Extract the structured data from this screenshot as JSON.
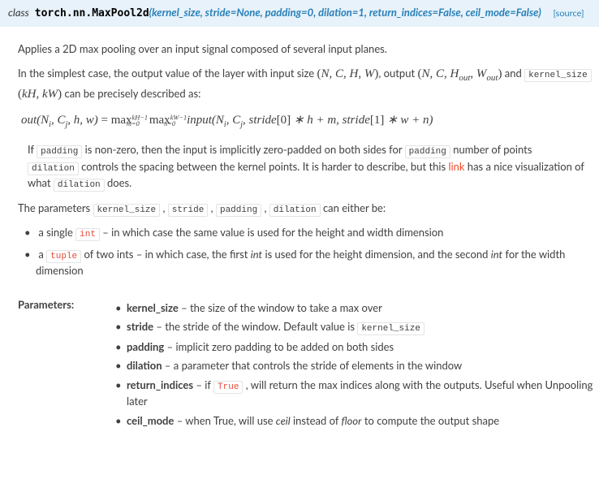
{
  "signature": {
    "keyword": "class",
    "module": "torch.nn.",
    "classname": "MaxPool2d",
    "args": "(kernel_size, stride=None, padding=0, dilation=1, return_indices=False, ceil_mode=False)",
    "source_label": "[source]"
  },
  "intro": "Applies a 2D max pooling over an input signal composed of several input planes.",
  "simple_case": {
    "prefix": "In the simplest case, the output value of the layer with input size ",
    "inout_sizes_1": "(N, C, H, W)",
    "mid1": ", output ",
    "inout_sizes_2": "(N, C, H_out, W_out)",
    "mid2": " and ",
    "ks_code": "kernel_size",
    "ks_math": " (kH, kW)",
    "suffix": " can be precisely described as:"
  },
  "formula_text": "out(N_i, C_j, h, w) = max_{m=0}^{kH-1} max_{n=0}^{kW-1} input(N_i, C_j, stride[0]*h + m, stride[1]*w + n)",
  "padding_note": {
    "p1a": "If ",
    "p1_code1": "padding",
    "p1b": " is non-zero, then the input is implicitly zero-padded on both sides for ",
    "p1_code2": "padding",
    "p1c": " number of points",
    "p2_code": "dilation",
    "p2a": " controls the spacing between the kernel points. It is harder to describe, but this ",
    "p2_link": "link",
    "p2b": " has a nice visualization of what ",
    "p2_code2": "dilation",
    "p2c": " does."
  },
  "either_be": {
    "prefix": "The parameters ",
    "codes": [
      "kernel_size",
      "stride",
      "padding",
      "dilation"
    ],
    "suffix": " can either be:"
  },
  "either_list": [
    {
      "pre": "a single ",
      "code": "int",
      "post": " – in which case the same value is used for the height and width dimension"
    },
    {
      "pre": "a ",
      "code": "tuple",
      "post1": " of two ints – in which case, the first ",
      "em1": "int",
      "post2": " is used for the height dimension, and the second ",
      "em2": "int",
      "post3": " for the width dimension"
    }
  ],
  "params_label": "Parameters:",
  "params": [
    {
      "name": "kernel_size",
      "desc": " – the size of the window to take a max over"
    },
    {
      "name": "stride",
      "desc": " – the stride of the window. Default value is ",
      "code": "kernel_size"
    },
    {
      "name": "padding",
      "desc": " – implicit zero padding to be added on both sides"
    },
    {
      "name": "dilation",
      "desc": " – a parameter that controls the stride of elements in the window"
    },
    {
      "name": "return_indices",
      "desc_pre": " – if ",
      "code": "True",
      "desc_post": " , will return the max indices along with the outputs. Useful when Unpooling later"
    },
    {
      "name": "ceil_mode",
      "desc_pre": " – when True, will use ",
      "em1": "ceil",
      "mid": " instead of ",
      "em2": "floor",
      "desc_post": " to compute the output shape"
    }
  ]
}
